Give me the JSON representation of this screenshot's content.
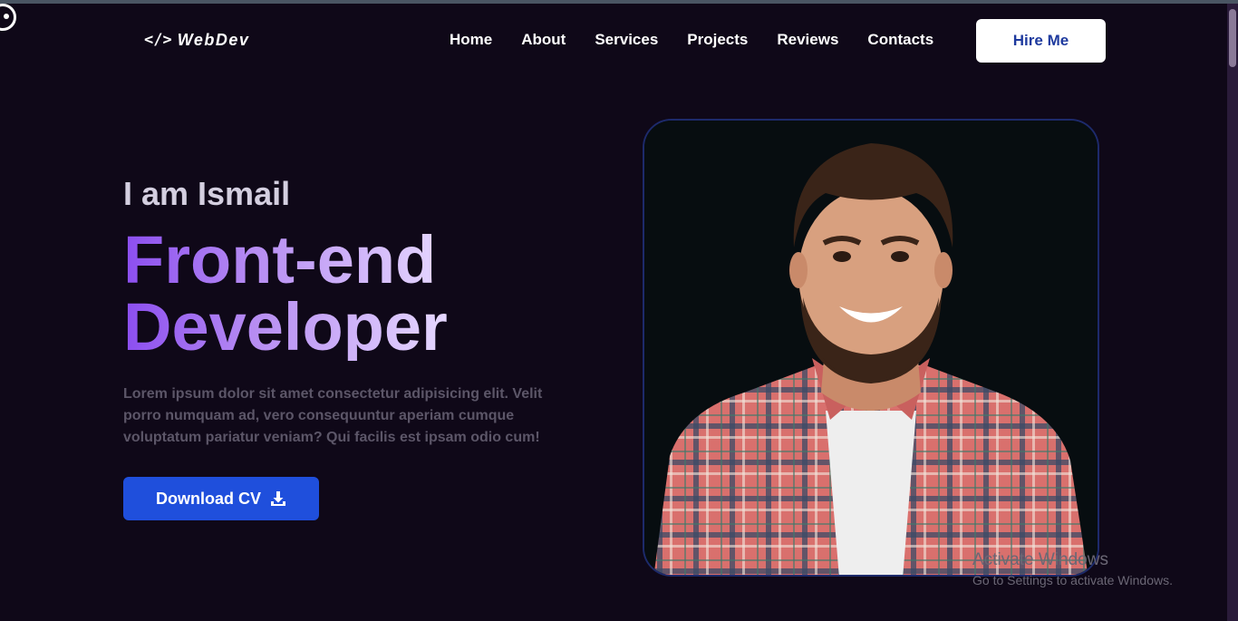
{
  "logo": {
    "code": "</>",
    "text": "WebDev"
  },
  "nav": [
    "Home",
    "About",
    "Services",
    "Projects",
    "Reviews",
    "Contacts"
  ],
  "hire_label": "Hire Me",
  "hero": {
    "intro": "I am Ismail",
    "line1": "Front-end",
    "line2": "Developer",
    "description": "Lorem ipsum dolor sit amet consectetur adipisicing elit. Velit porro numquam ad, vero consequuntur aperiam cumque voluptatum pariatur veniam? Qui facilis est ipsam odio cum!",
    "cv_label": "Download CV"
  },
  "watermark": {
    "line1": "Activate Windows",
    "line2": "Go to Settings to activate Windows."
  },
  "colors": {
    "background": "#0f0818",
    "accent": "#1f4fdc",
    "gradient_start": "#8b4df0",
    "gradient_end": "#e6d8ff"
  }
}
